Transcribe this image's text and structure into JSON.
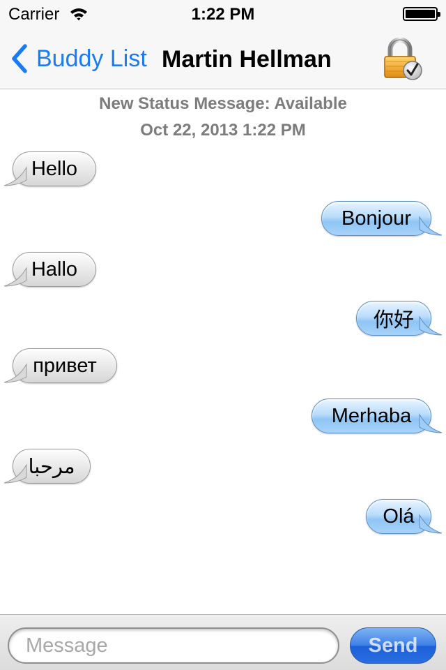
{
  "status_bar": {
    "carrier": "Carrier",
    "time": "1:22 PM",
    "battery_level": 1.0
  },
  "nav": {
    "back_label": "Buddy List",
    "title": "Martin Hellman",
    "lock_icon": "padlock-check-icon"
  },
  "status_message": {
    "line1": "New Status Message: Available",
    "line2": "Oct 22, 2013 1:22 PM"
  },
  "messages": [
    {
      "direction": "incoming",
      "text": "Hello"
    },
    {
      "direction": "outgoing",
      "text": "Bonjour"
    },
    {
      "direction": "incoming",
      "text": "Hallo"
    },
    {
      "direction": "outgoing",
      "text": "你好"
    },
    {
      "direction": "incoming",
      "text": "привет"
    },
    {
      "direction": "outgoing",
      "text": "Merhaba"
    },
    {
      "direction": "incoming",
      "text": "مرحبا"
    },
    {
      "direction": "outgoing",
      "text": "Olá"
    }
  ],
  "compose": {
    "placeholder": "Message",
    "value": "",
    "send_label": "Send"
  },
  "colors": {
    "accent": "#1a7cf5",
    "incoming_bubble": "#e6e6e6",
    "outgoing_bubble": "#b9dcfb",
    "status_text": "#7c7c7c"
  }
}
